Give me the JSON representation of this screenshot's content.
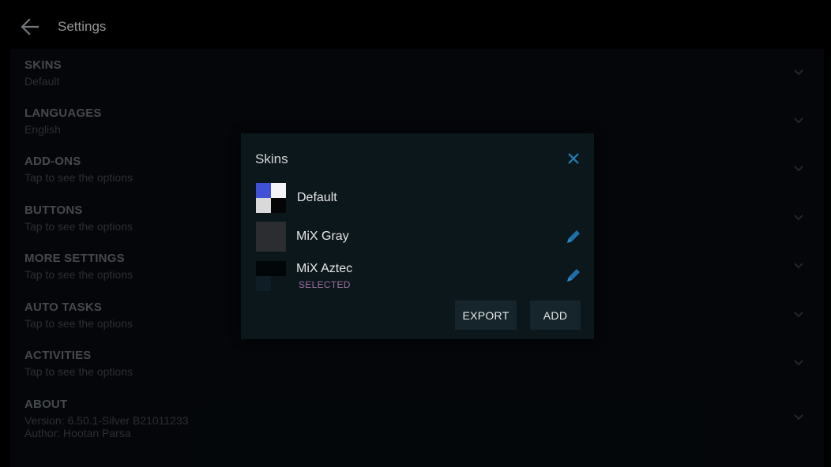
{
  "header": {
    "title": "Settings",
    "back_icon": "arrow-left-icon"
  },
  "settings": [
    {
      "label": "SKINS",
      "sub": "Default"
    },
    {
      "label": "LANGUAGES",
      "sub": "English"
    },
    {
      "label": "ADD-ONS",
      "sub": "Tap to see the options"
    },
    {
      "label": "BUTTONS",
      "sub": "Tap to see the options"
    },
    {
      "label": "MORE SETTINGS",
      "sub": "Tap to see the options"
    },
    {
      "label": "AUTO TASKS",
      "sub": "Tap to see the options"
    },
    {
      "label": "ACTIVITIES",
      "sub": "Tap to see the options"
    },
    {
      "label": "ABOUT",
      "sub": "Version: 6.50.1-Silver  B21011233",
      "sub2": "Author: Hootan Parsa"
    }
  ],
  "dialog": {
    "title": "Skins",
    "skins": [
      {
        "name": "Default",
        "badge": ""
      },
      {
        "name": "MiX Gray",
        "badge": ""
      },
      {
        "name": "MiX Aztec",
        "badge": "SELECTED"
      }
    ],
    "export_label": "EXPORT",
    "add_label": "ADD"
  },
  "colors": {
    "background": "#000000",
    "panel": "#06090d",
    "dialog": "#0c171c",
    "accent": "#1f7fb5",
    "selected_badge": "#9a6fa0"
  }
}
